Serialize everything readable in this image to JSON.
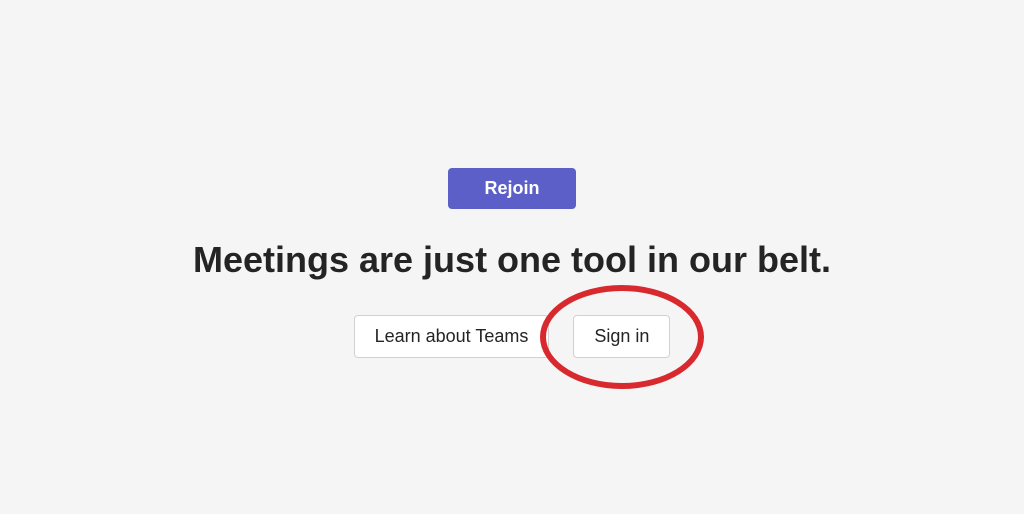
{
  "rejoin": {
    "label": "Rejoin"
  },
  "headline": "Meetings are just one tool in our belt.",
  "actions": {
    "learn": "Learn about Teams",
    "signin": "Sign in"
  },
  "colors": {
    "accent": "#5b5fc7",
    "highlight": "#d8292f"
  }
}
